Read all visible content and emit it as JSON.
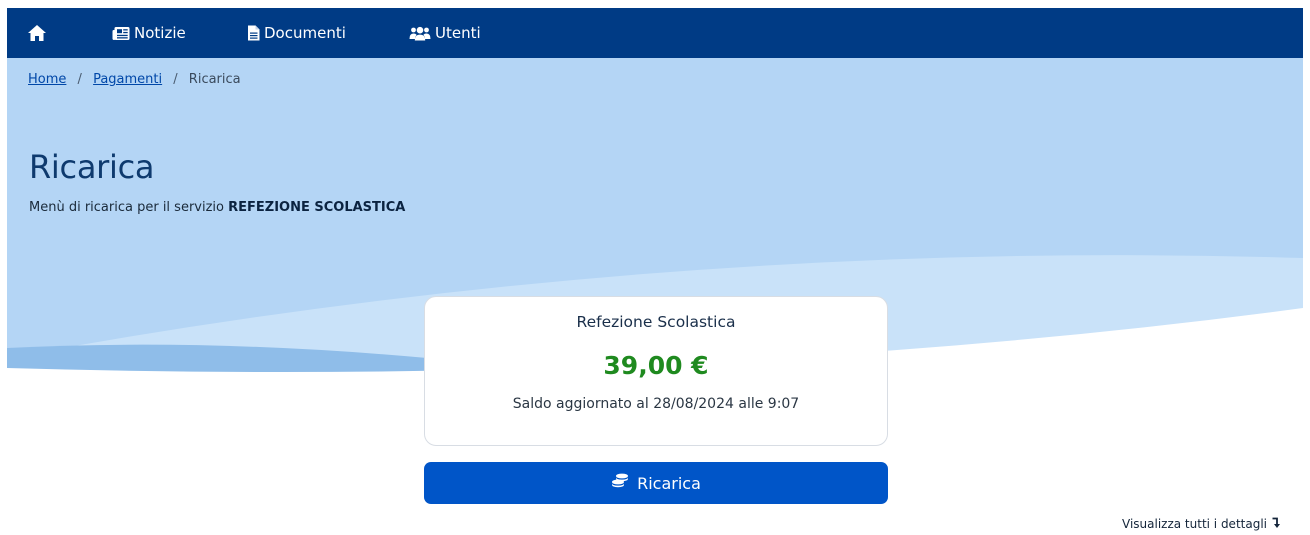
{
  "nav": {
    "home_icon": "home-icon",
    "items": [
      {
        "label": "Notizie",
        "icon": "newspaper-icon"
      },
      {
        "label": "Documenti",
        "icon": "document-icon"
      },
      {
        "label": "Utenti",
        "icon": "users-icon"
      }
    ]
  },
  "breadcrumb": {
    "items": [
      {
        "label": "Home"
      },
      {
        "label": "Pagamenti"
      }
    ],
    "separator": "/",
    "current": "Ricarica"
  },
  "header": {
    "title": "Ricarica",
    "subtitle_prefix": "Menù di ricarica per il servizio",
    "subtitle_service": "REFEZIONE SCOLASTICA"
  },
  "balance_card": {
    "title": "Refezione Scolastica",
    "amount": "39,00 €",
    "updated": "Saldo aggiornato al 28/08/2024 alle 9:07"
  },
  "actions": {
    "recharge_label": "Ricarica",
    "recharge_icon": "coins-icon",
    "details_label": "Visualizza tutti i dettagli",
    "details_icon": "arrow-down-turn-icon"
  },
  "colors": {
    "navbar": "#003b85",
    "hero_light": "#b5d6f5",
    "primary_button": "#0055c8",
    "amount": "#1f8a1f",
    "title": "#0e3a6e"
  }
}
